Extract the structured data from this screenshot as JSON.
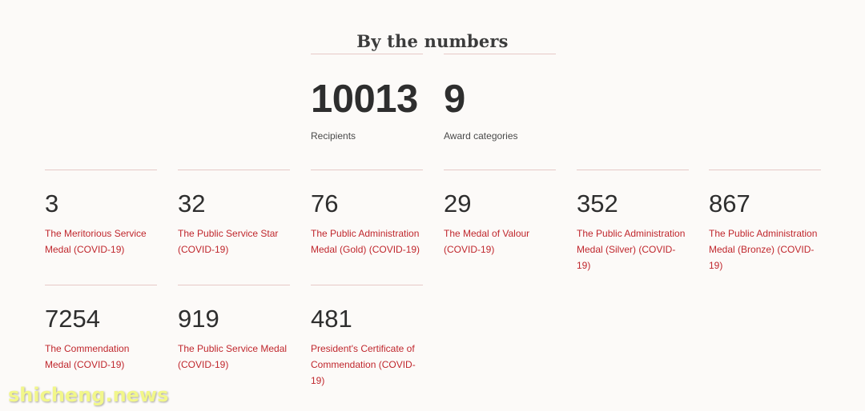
{
  "title": "By the numbers",
  "summary": [
    {
      "value": "10013",
      "label": "Recipients"
    },
    {
      "value": "9",
      "label": "Award categories"
    }
  ],
  "awards": [
    {
      "count": "3",
      "name": "The Meritorious Service Medal (COVID-19)"
    },
    {
      "count": "32",
      "name": "The Public Service Star (COVID-19)"
    },
    {
      "count": "76",
      "name": "The Public Administration Medal (Gold) (COVID-19)"
    },
    {
      "count": "29",
      "name": "The Medal of Valour (COVID-19)"
    },
    {
      "count": "352",
      "name": "The Public Administration Medal (Silver) (COVID-19)"
    },
    {
      "count": "867",
      "name": "The Public Administration Medal (Bronze) (COVID-19)"
    },
    {
      "count": "7254",
      "name": "The Commendation Medal (COVID-19)"
    },
    {
      "count": "919",
      "name": "The Public Service Medal (COVID-19)"
    },
    {
      "count": "481",
      "name": "President's Certificate of Commendation (COVID-19)"
    }
  ],
  "watermark": "shicheng.news",
  "colors": {
    "background": "#fcfaf8",
    "accent": "#c0272d",
    "divider": "#e6c9c7"
  }
}
